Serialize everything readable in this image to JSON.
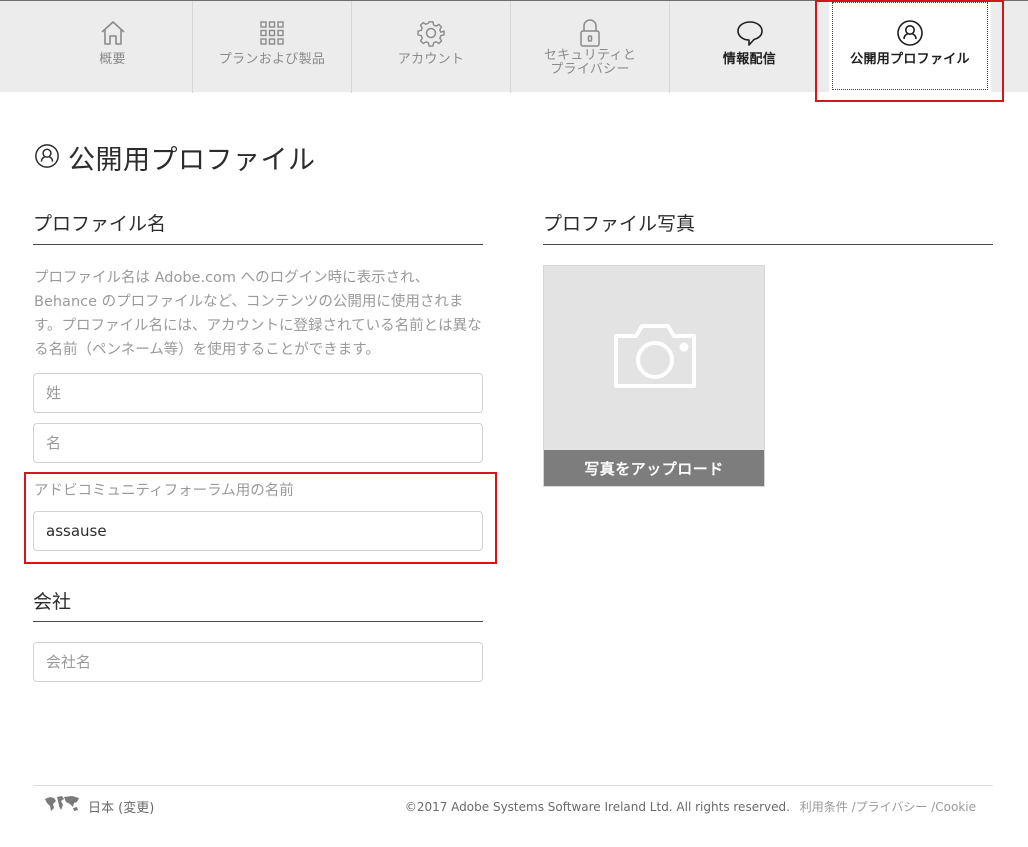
{
  "nav": {
    "tabs": [
      {
        "label": "概要",
        "icon": "home-icon"
      },
      {
        "label": "プランおよび製品",
        "icon": "grid-icon"
      },
      {
        "label": "アカウント",
        "icon": "gear-icon"
      },
      {
        "label": "セキュリティと\nプライバシー",
        "icon": "lock-icon"
      },
      {
        "label": "情報配信",
        "icon": "speech-bubble-icon"
      },
      {
        "label": "公開用プロファイル",
        "icon": "user-profile-icon"
      }
    ],
    "active_index": 5
  },
  "page": {
    "title": "公開用プロファイル",
    "title_icon": "user-profile-icon"
  },
  "profile_name": {
    "heading": "プロファイル名",
    "description": "プロファイル名は Adobe.com へのログイン時に表示され、Behance のプロファイルなど、コンテンツの公開用に使用されます。プロファイル名には、アカウントに登録されている名前とは異なる名前（ペンネーム等）を使用することができます。",
    "last_name_placeholder": "姓",
    "first_name_placeholder": "名",
    "forum_label": "アドビコミュニティフォーラム用の名前",
    "forum_value": "assause"
  },
  "company": {
    "heading": "会社",
    "placeholder": "会社名"
  },
  "photo": {
    "heading": "プロファイル写真",
    "upload_label": "写真をアップロード",
    "icon": "camera-icon"
  },
  "footer": {
    "language": "日本 (変更)",
    "copyright": "©2017 Adobe Systems Software Ireland Ltd. All rights reserved.",
    "terms": "利用条件",
    "privacy": "プライバシー",
    "cookie": "Cookie"
  },
  "colors": {
    "nav_bg": "#ececec",
    "highlight_red": "#d7141a",
    "upload_button_bg": "#7d7d7d"
  }
}
